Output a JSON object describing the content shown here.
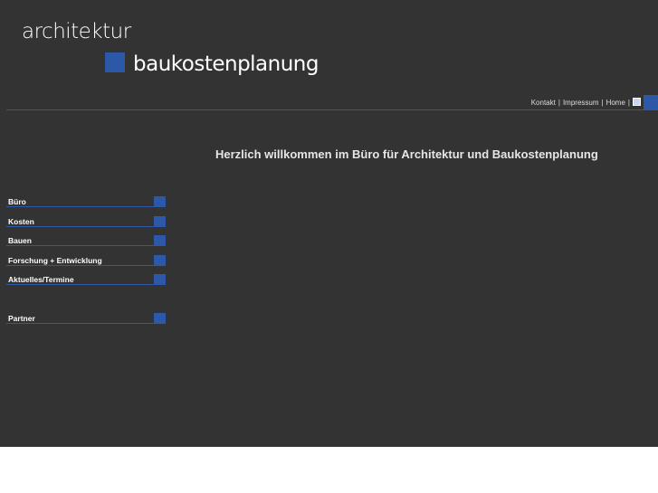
{
  "logo": {
    "line1": "architektur",
    "line2": "baukostenplanung"
  },
  "topnav": {
    "items": [
      "Kontakt",
      "Impressum",
      "Home"
    ],
    "separator": "|"
  },
  "welcome": "Herzlich willkommen im Büro für Architektur und Baukostenplanung",
  "menu": [
    "Büro",
    "Kosten",
    "Bauen",
    "Forschung + Entwicklung",
    "Aktuelles/Termine",
    "Partner"
  ],
  "colors": {
    "background": "#333333",
    "accent": "#2d58a8"
  }
}
